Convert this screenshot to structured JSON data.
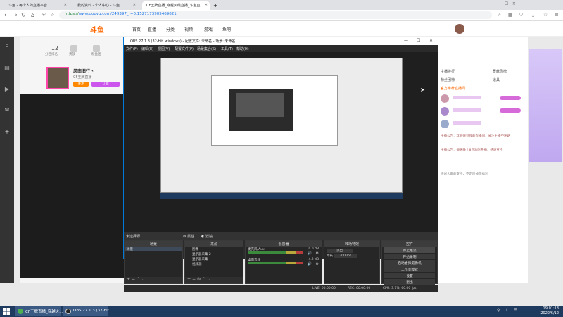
{
  "browser": {
    "tabs": [
      {
        "label": "斗鱼 - 每个人的直播平台",
        "active": false
      },
      {
        "label": "我的资料 - 个人中心 - 斗鱼",
        "active": false
      },
      {
        "label": "CF王牌直播_穿越火线直播_斗鱼直",
        "active": true
      }
    ],
    "url_prefix": "https://",
    "url": "www.douyu.com/249397_r=0.1527173905469621",
    "icons": [
      "back-icon",
      "forward-icon",
      "refresh-icon",
      "home-icon",
      "menu-icon"
    ]
  },
  "site": {
    "logo": "斗鱼",
    "nav": [
      "首页",
      "直播",
      "分类",
      "视频",
      "游戏",
      "鱼吧"
    ],
    "stats": [
      {
        "num": "12",
        "label": "分区排名"
      },
      {
        "num": "",
        "label": "贵族"
      },
      {
        "num": "",
        "label": "粉丝团"
      }
    ],
    "room_name": "风南旧行丶",
    "room_sub": "CF王牌直播",
    "tags": [
      "关注",
      "订阅"
    ],
    "chat_labels": [
      "主播排行",
      "贡献周榜",
      "粉丝团榜",
      "道具"
    ],
    "gift_title": "官方推荐直播间",
    "chat": [
      "主播公告：欢迎来到我的直播间，关注主播不迷路",
      "主播公告：每天晚上8点准时开播，感谢支持"
    ],
    "notice": "感谢大家的支持，不定时掉落福利"
  },
  "obs": {
    "title": "OBS 27.1.3 (32-bit, windows) - 配置文件: 未命名 - 场景: 未命名",
    "menu": [
      "文件(F)",
      "编辑(E)",
      "视图(V)",
      "配置文件(P)",
      "场景集合(S)",
      "工具(T)",
      "帮助(H)"
    ],
    "no_source": "未选择源",
    "source_props": [
      "属性",
      "滤镜"
    ],
    "docks": {
      "scenes": "场景",
      "sources": "来源",
      "mixer": "混音器",
      "transitions": "转场特效",
      "controls": "控件"
    },
    "scenes": [
      "场景"
    ],
    "sources": [
      "图像",
      "显示器采集 2",
      "显示器采集",
      "视频源"
    ],
    "mixer": [
      {
        "name": "麦克风/Aux",
        "db": "0.0 dB"
      },
      {
        "name": "桌面音频",
        "db": "-4.2 dB"
      }
    ],
    "transition": {
      "type": "淡出",
      "duration_label": "时长",
      "duration": "300 ms"
    },
    "controls": [
      "停止推流",
      "开始录制",
      "启动虚拟摄像机",
      "工作室模式",
      "设置",
      "退出"
    ],
    "status": {
      "live": "LIVE: 00:00:00",
      "rec": "REC: 00:00:00",
      "cpu": "CPU: 3.7%, 60.00 fps"
    }
  },
  "taskbar": {
    "tasks": [
      "CF王牌直播_穿越火...",
      "OBS 27.1.3 (32-bit..."
    ],
    "time": "19:01:18",
    "date": "2022/6/12"
  },
  "colors": {
    "accent": "#0078d7",
    "brand": "#ff6600",
    "obs_bg": "#2b2b2b"
  }
}
